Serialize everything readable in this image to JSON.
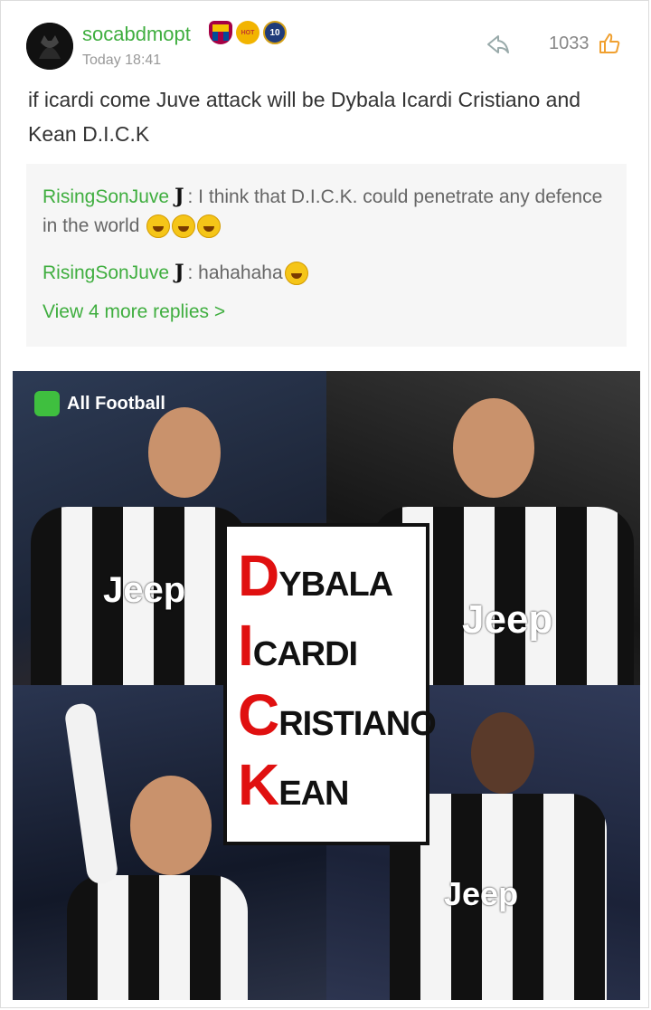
{
  "post": {
    "username": "socabdmopt",
    "time": "Today 18:41",
    "likes": "1033",
    "text": "if icardi come Juve attack will be Dybala Icardi Cristiano and Kean D.I.C.K"
  },
  "badges": [
    {
      "name": "fc-barcelona-badge",
      "color": "#a50044"
    },
    {
      "name": "hot-badge",
      "label": "HOT",
      "color": "#f2b400"
    },
    {
      "name": "top10-badge",
      "label": "10",
      "color": "#1f3b7a"
    }
  ],
  "replies": [
    {
      "author": "RisingSonJuve",
      "text": ": I think that D.I.C.K. could penetrate any defence in the world",
      "emoji_count": 3
    },
    {
      "author": "RisingSonJuve",
      "text": ": hahahaha",
      "emoji_count": 1
    }
  ],
  "more_replies": "View 4 more replies >",
  "image": {
    "watermark": "All Football",
    "jersey_sponsor": "Jeep",
    "acronym": [
      {
        "initial": "D",
        "rest": "YBALA"
      },
      {
        "initial": "I",
        "rest": "CARDI"
      },
      {
        "initial": "C",
        "rest": "RISTIANO"
      },
      {
        "initial": "K",
        "rest": "EAN"
      }
    ]
  },
  "colors": {
    "accent_green": "#3fae3f",
    "acronym_red": "#e01010"
  }
}
